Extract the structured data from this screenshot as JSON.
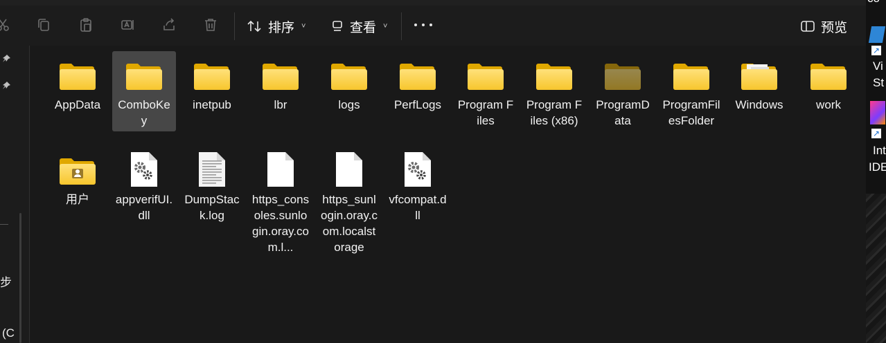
{
  "toolbar": {
    "icons": [
      "cut-icon",
      "copy-icon",
      "paste-icon",
      "rename-icon",
      "share-icon",
      "delete-icon"
    ],
    "sort_label": "排序",
    "view_label": "查看",
    "more_label": "···",
    "preview_label": "预览"
  },
  "nav": {
    "partial_text_1": "步",
    "partial_text_2": "(C"
  },
  "items": [
    {
      "name": "AppData",
      "icon": "folder-icon"
    },
    {
      "name": "ComboKey",
      "icon": "folder-icon",
      "selected": true
    },
    {
      "name": "inetpub",
      "icon": "folder-icon"
    },
    {
      "name": "lbr",
      "icon": "folder-icon"
    },
    {
      "name": "logs",
      "icon": "folder-icon"
    },
    {
      "name": "PerfLogs",
      "icon": "folder-icon"
    },
    {
      "name": "Program Files",
      "icon": "folder-icon"
    },
    {
      "name": "Program Files (x86)",
      "icon": "folder-icon"
    },
    {
      "name": "ProgramData",
      "icon": "hidden-folder-icon"
    },
    {
      "name": "ProgramFilesFolder",
      "icon": "folder-icon"
    },
    {
      "name": "Windows",
      "icon": "folder-with-docs-icon"
    },
    {
      "name": "work",
      "icon": "folder-icon"
    },
    {
      "name": "用户",
      "icon": "user-folder-icon"
    },
    {
      "name": "appverifUI.dll",
      "icon": "dll-file-icon"
    },
    {
      "name": "DumpStack.log",
      "icon": "text-file-icon"
    },
    {
      "name": "https_consoles.sunlogin.oray.com.l...",
      "icon": "blank-file-icon"
    },
    {
      "name": "https_sunlogin.oray.com.localstorage",
      "icon": "blank-file-icon"
    },
    {
      "name": "vfcompat.dll",
      "icon": "dll-file-icon"
    }
  ],
  "desktop": {
    "text_co": "co",
    "text_vi": "Vi",
    "text_st": "St",
    "text_int": "Int",
    "text_ide": "IDE"
  }
}
